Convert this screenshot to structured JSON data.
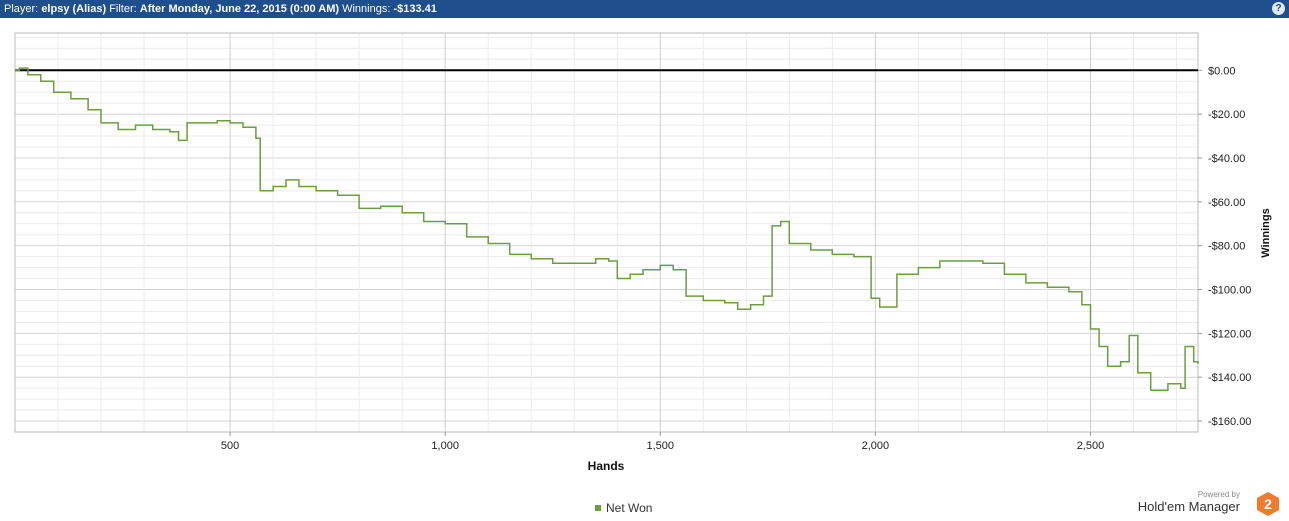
{
  "header": {
    "player_label": "Player:",
    "player_value": "elpsy (Alias)",
    "filter_label": "Filter:",
    "filter_value": "After Monday, June 22, 2015 (0:00 AM)",
    "winnings_label": "Winnings:",
    "winnings_value": "-$133.41",
    "help_label": "?"
  },
  "legend": {
    "net_won_label": "Net Won"
  },
  "branding": {
    "powered_by": "Powered by",
    "product": "Hold'em Manager",
    "logo_glyph": "2"
  },
  "colors": {
    "header_bg": "#1f4e8c",
    "series": "#6a9e3f",
    "zero_line": "#000000",
    "logo": "#f07a2e"
  },
  "chart_data": {
    "type": "line",
    "xlabel": "Hands",
    "ylabel": "Winnings",
    "xlim": [
      0,
      2750
    ],
    "ylim": [
      -165,
      17
    ],
    "x_ticks": [
      500,
      1000,
      1500,
      2000,
      2500
    ],
    "x_tick_labels": [
      "500",
      "1,000",
      "1,500",
      "2,000",
      "2,500"
    ],
    "y_ticks": [
      0,
      -20,
      -40,
      -60,
      -80,
      -100,
      -120,
      -140,
      -160
    ],
    "y_tick_labels": [
      "$0.00",
      "-$20.00",
      "-$40.00",
      "-$60.00",
      "-$80.00",
      "-$100.00",
      "-$120.00",
      "-$140.00",
      "-$160.00"
    ],
    "grid": true,
    "legend": "bottom-center",
    "series": [
      {
        "name": "Net Won",
        "points": [
          [
            0,
            0
          ],
          [
            10,
            1
          ],
          [
            30,
            -2
          ],
          [
            60,
            -5
          ],
          [
            90,
            -10
          ],
          [
            130,
            -13
          ],
          [
            170,
            -18
          ],
          [
            200,
            -24
          ],
          [
            240,
            -27
          ],
          [
            280,
            -25
          ],
          [
            320,
            -27
          ],
          [
            360,
            -28
          ],
          [
            380,
            -32
          ],
          [
            400,
            -24
          ],
          [
            440,
            -24
          ],
          [
            470,
            -23
          ],
          [
            500,
            -24
          ],
          [
            530,
            -26
          ],
          [
            560,
            -31
          ],
          [
            570,
            -55
          ],
          [
            600,
            -53
          ],
          [
            630,
            -50
          ],
          [
            660,
            -53
          ],
          [
            700,
            -55
          ],
          [
            750,
            -57
          ],
          [
            800,
            -63
          ],
          [
            850,
            -62
          ],
          [
            900,
            -65
          ],
          [
            950,
            -69
          ],
          [
            1000,
            -70
          ],
          [
            1050,
            -76
          ],
          [
            1100,
            -79
          ],
          [
            1150,
            -84
          ],
          [
            1200,
            -86
          ],
          [
            1250,
            -88
          ],
          [
            1300,
            -88
          ],
          [
            1350,
            -86
          ],
          [
            1380,
            -87
          ],
          [
            1400,
            -95
          ],
          [
            1430,
            -93
          ],
          [
            1460,
            -91
          ],
          [
            1500,
            -89
          ],
          [
            1530,
            -91
          ],
          [
            1560,
            -103
          ],
          [
            1600,
            -105
          ],
          [
            1650,
            -106
          ],
          [
            1680,
            -109
          ],
          [
            1710,
            -107
          ],
          [
            1740,
            -103
          ],
          [
            1760,
            -71
          ],
          [
            1780,
            -69
          ],
          [
            1800,
            -79
          ],
          [
            1850,
            -82
          ],
          [
            1900,
            -84
          ],
          [
            1950,
            -85
          ],
          [
            1990,
            -104
          ],
          [
            2010,
            -108
          ],
          [
            2050,
            -93
          ],
          [
            2100,
            -90
          ],
          [
            2150,
            -87
          ],
          [
            2200,
            -87
          ],
          [
            2250,
            -88
          ],
          [
            2300,
            -93
          ],
          [
            2350,
            -97
          ],
          [
            2400,
            -99
          ],
          [
            2450,
            -101
          ],
          [
            2480,
            -107
          ],
          [
            2500,
            -118
          ],
          [
            2520,
            -126
          ],
          [
            2540,
            -135
          ],
          [
            2570,
            -133
          ],
          [
            2590,
            -121
          ],
          [
            2610,
            -138
          ],
          [
            2640,
            -146
          ],
          [
            2680,
            -143
          ],
          [
            2710,
            -145
          ],
          [
            2720,
            -126
          ],
          [
            2740,
            -133
          ],
          [
            2750,
            -134
          ]
        ]
      }
    ]
  }
}
